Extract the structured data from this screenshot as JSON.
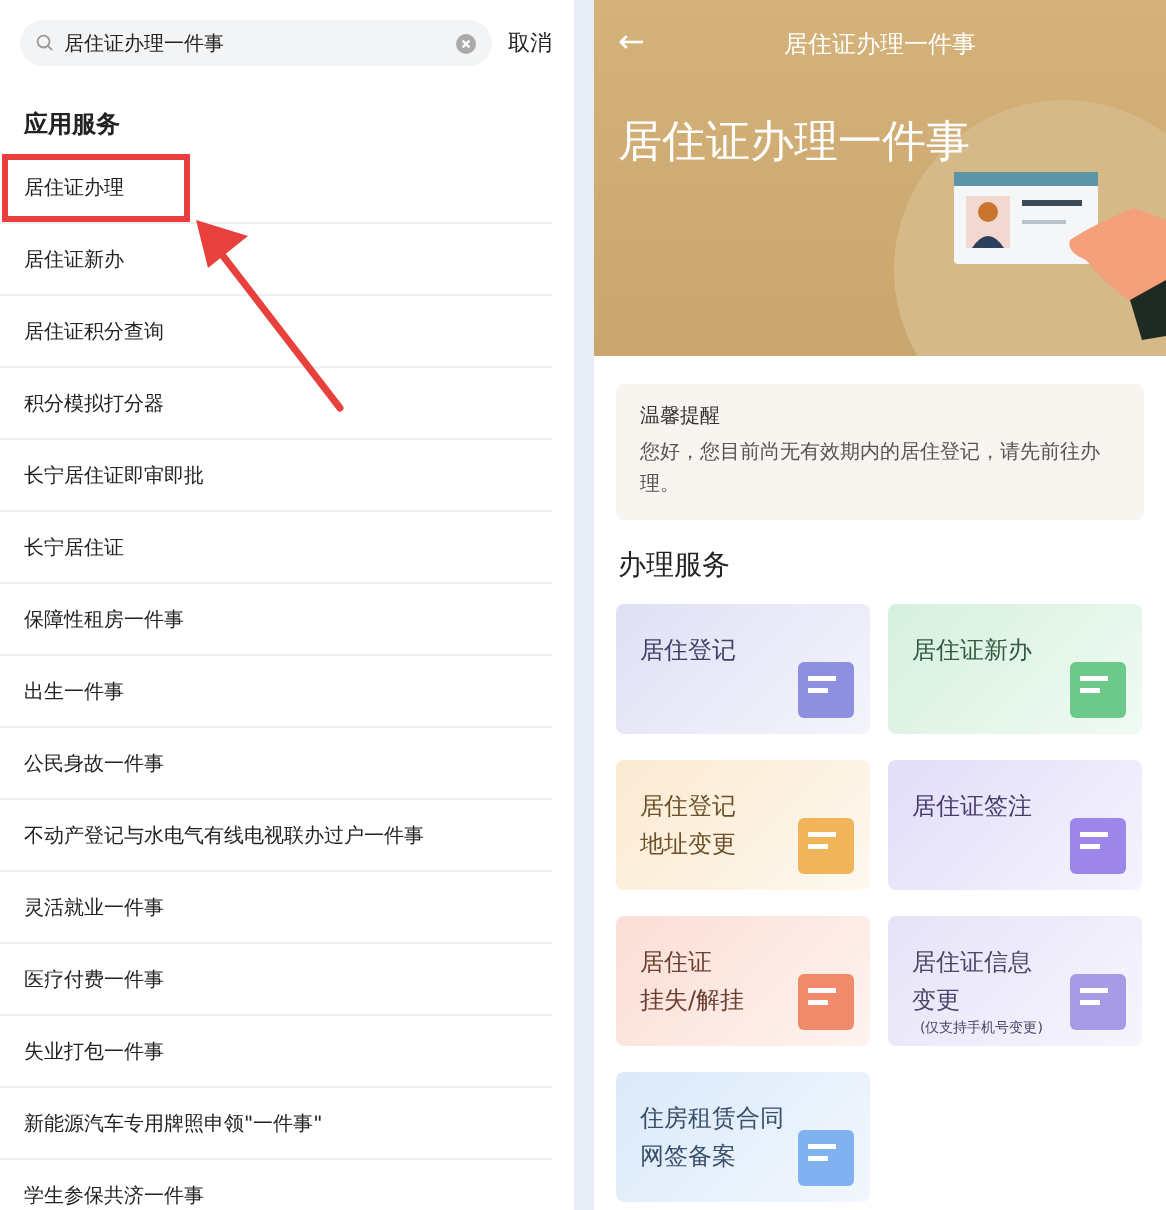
{
  "search": {
    "value": "居住证办理一件事",
    "cancel": "取消"
  },
  "results": {
    "heading": "应用服务",
    "items": [
      {
        "label": "居住证办理",
        "highlighted": true
      },
      {
        "label": "居住证新办",
        "highlighted": false
      },
      {
        "label": "居住证积分查询",
        "highlighted": false
      },
      {
        "label": "积分模拟打分器",
        "highlighted": false
      },
      {
        "label": "长宁居住证即审即批",
        "highlighted": false
      },
      {
        "label": "长宁居住证",
        "highlighted": false
      },
      {
        "label": "保障性租房一件事",
        "highlighted": false
      },
      {
        "label": "出生一件事",
        "highlighted": false
      },
      {
        "label": "公民身故一件事",
        "highlighted": false
      },
      {
        "label": "不动产登记与水电气有线电视联办过户一件事",
        "highlighted": false
      },
      {
        "label": "灵活就业一件事",
        "highlighted": false
      },
      {
        "label": "医疗付费一件事",
        "highlighted": false
      },
      {
        "label": "失业打包一件事",
        "highlighted": false
      },
      {
        "label": "新能源汽车专用牌照申领\"一件事\"",
        "highlighted": false
      },
      {
        "label": "学生参保共济一件事",
        "highlighted": false
      }
    ]
  },
  "detail": {
    "back": "←",
    "title": "居住证办理一件事",
    "banner_title": "居住证办理一件事",
    "notice": {
      "title": "温馨提醒",
      "text": "您好，您目前尚无有效期内的居住登记，请先前往办理。"
    },
    "services_heading": "办理服务",
    "services": [
      {
        "lines": [
          "居住登记"
        ],
        "color": "#8f8fe0"
      },
      {
        "lines": [
          "居住证新办"
        ],
        "color": "#6cc98a"
      },
      {
        "lines": [
          "居住登记",
          "地址变更"
        ],
        "color": "#f0b55a"
      },
      {
        "lines": [
          "居住证签注"
        ],
        "color": "#9c86ea"
      },
      {
        "lines": [
          "居住证",
          "挂失/解挂"
        ],
        "color": "#f08a6a"
      },
      {
        "lines": [
          "居住证信息",
          "变更"
        ],
        "note": "(仅支持手机号变更)",
        "color": "#a79be6"
      },
      {
        "lines": [
          "住房租赁合同",
          "网签备案"
        ],
        "color": "#7fb2ee"
      }
    ]
  }
}
